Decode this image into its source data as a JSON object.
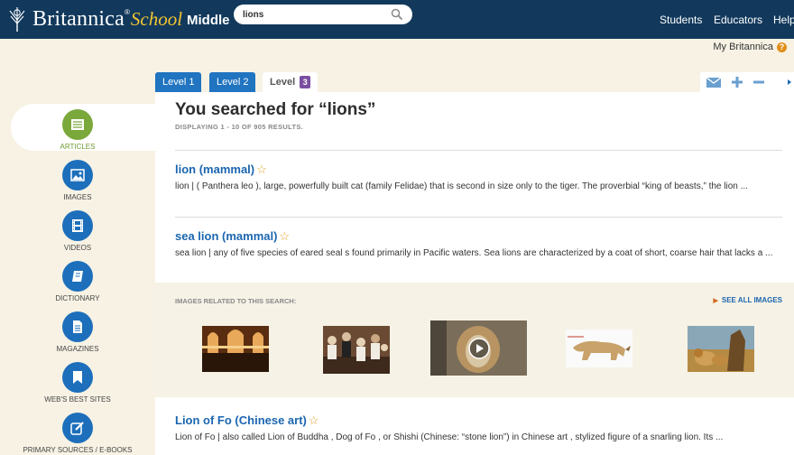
{
  "header": {
    "brand": "Britannica",
    "brand_mark": "®",
    "school": "School",
    "level": "Middle",
    "search": {
      "value": "lions",
      "placeholder": ""
    },
    "nav": [
      "Students",
      "Educators",
      "Help"
    ],
    "my_britannica": "My Britannica",
    "help_glyph": "?"
  },
  "tabs": [
    {
      "label": "Level 1"
    },
    {
      "label": "Level 2"
    },
    {
      "label": "Level",
      "badge": "3"
    }
  ],
  "search_results": {
    "heading": "You searched for “lions”",
    "count": "DISPLAYING 1 - 10 OF 905 RESULTS.",
    "items": [
      {
        "title": "lion (mammal)",
        "snippet": "lion   | ( Panthera leo ),    large, powerfully built cat (family Felidae) that is second in size only to the tiger. The proverbial “king of beasts,” the lion ..."
      },
      {
        "title": "sea lion (mammal)",
        "snippet": "sea lion   |   any of five species of eared  seal s found primarily in Pacific waters. Sea lions are characterized by a coat of short, coarse hair that lacks a ..."
      },
      {
        "title": "Lion of Fo (Chinese art)",
        "snippet": "Lion of Fo   |   also called Lion of Buddha  , Dog of Fo , or Shishi (Chinese: “stone lion”)   in Chinese art  , stylized figure of a snarling lion. Its ..."
      }
    ],
    "star": "☆"
  },
  "images_panel": {
    "label": "IMAGES RELATED TO THIS SEARCH:",
    "see_all": "SEE ALL IMAGES",
    "thumbnails": [
      {
        "name": "thumb-interior-photo"
      },
      {
        "name": "thumb-team-photo"
      },
      {
        "name": "thumb-lion-video",
        "is_video": true
      },
      {
        "name": "thumb-lion-illustration"
      },
      {
        "name": "thumb-lions-photo"
      }
    ]
  },
  "sidebar": {
    "items": [
      {
        "label": "ARTICLES",
        "icon": "list-icon",
        "active": true
      },
      {
        "label": "IMAGES",
        "icon": "image-icon"
      },
      {
        "label": "VIDEOS",
        "icon": "film-icon"
      },
      {
        "label": "DICTIONARY",
        "icon": "book-icon"
      },
      {
        "label": "MAGAZINES",
        "icon": "document-icon"
      },
      {
        "label": "WEB'S BEST SITES",
        "icon": "bookmark-icon"
      },
      {
        "label": "PRIMARY SOURCES / E-BOOKS",
        "icon": "edit-icon"
      }
    ]
  },
  "colors": {
    "header_bg": "#12395c",
    "accent_blue": "#1b66b0",
    "school_yellow": "#f3c431",
    "articles_green": "#7aa83b",
    "level3_purple": "#7b4fa0",
    "page_bg": "#f7f2e4"
  }
}
